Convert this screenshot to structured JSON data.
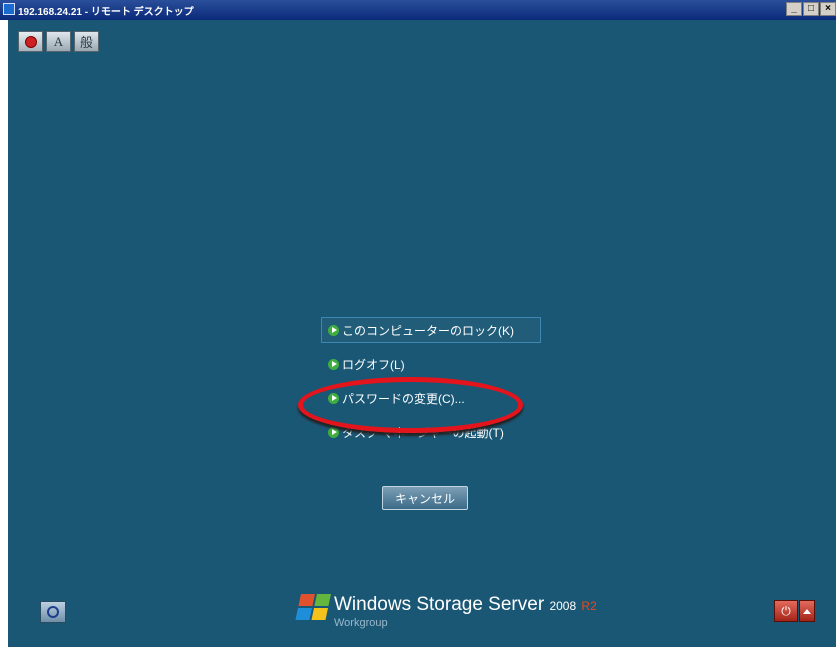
{
  "window": {
    "title": "192.168.24.21 - リモート デスクトップ",
    "buttons": [
      "_",
      "□",
      "×"
    ]
  },
  "toolbar": {
    "pin_icon": "pin-icon",
    "ime_mode": "A",
    "ime_input": "般"
  },
  "menu": {
    "items": [
      {
        "label": "このコンピューターのロック(K)"
      },
      {
        "label": "ログオフ(L)"
      },
      {
        "label": "パスワードの変更(C)..."
      },
      {
        "label": "タスク マネージャーの起動(T)"
      }
    ]
  },
  "cancel_label": "キャンセル",
  "branding": {
    "product": "Windows Storage Server",
    "version": "2008",
    "release": "R2",
    "edition": "Workgroup"
  },
  "colors": {
    "desktop": "#1a5775",
    "annotation": "#e3141b"
  }
}
